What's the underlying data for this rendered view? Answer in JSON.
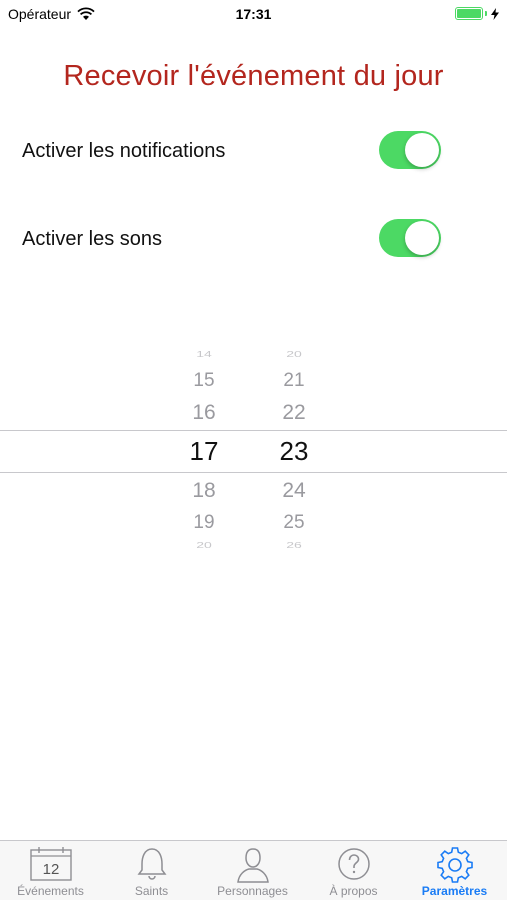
{
  "status": {
    "carrier": "Opérateur",
    "time": "17:31",
    "battery_color": "#4cd964"
  },
  "title": "Recevoir l'événement du jour",
  "settings": [
    {
      "label": "Activer les notifications",
      "on": true
    },
    {
      "label": "Activer les sons",
      "on": true
    }
  ],
  "picker": {
    "hours": [
      "14",
      "15",
      "16",
      "17",
      "18",
      "19",
      "20"
    ],
    "minutes": [
      "20",
      "21",
      "22",
      "23",
      "24",
      "25",
      "26"
    ],
    "selected_hour": "17",
    "selected_minute": "23"
  },
  "tabs": [
    {
      "label": "Événements",
      "icon": "calendar-icon",
      "calendar_day": "12",
      "active": false
    },
    {
      "label": "Saints",
      "icon": "bell-icon",
      "active": false
    },
    {
      "label": "Personnages",
      "icon": "person-icon",
      "active": false
    },
    {
      "label": "À propos",
      "icon": "question-icon",
      "active": false
    },
    {
      "label": "Paramètres",
      "icon": "gear-icon",
      "active": true
    }
  ],
  "colors": {
    "title": "#b3261e",
    "toggle_on": "#4cd964",
    "tab_active": "#1a7cf5",
    "tab_inactive": "#8e8e93"
  }
}
